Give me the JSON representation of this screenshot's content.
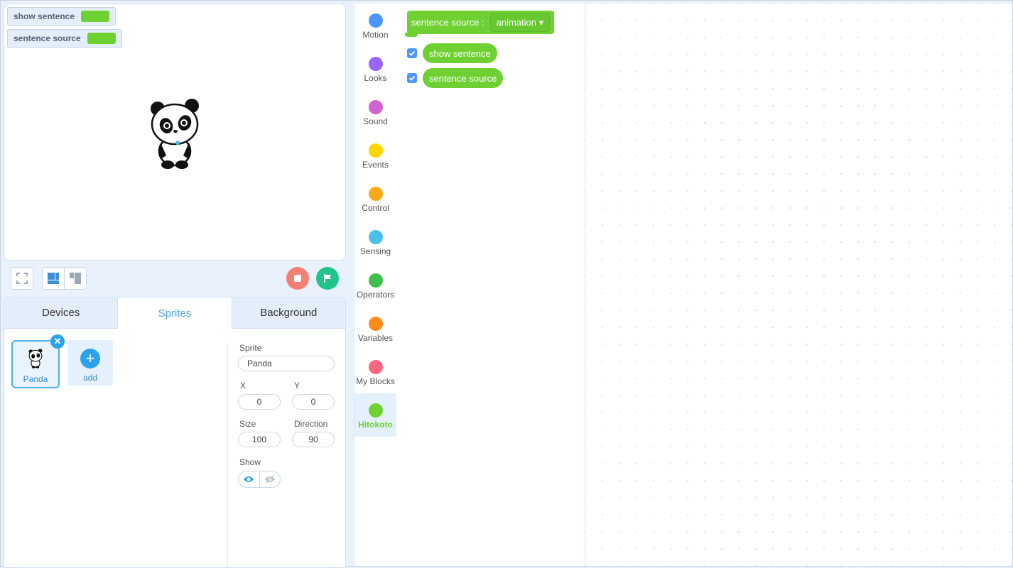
{
  "stage": {
    "monitors": [
      {
        "label": "show sentence"
      },
      {
        "label": "sentence source"
      }
    ],
    "sprite_icon": "panda-icon"
  },
  "stage_controls": {
    "fullscreen_icon": "fullscreen-icon",
    "layout_icons": [
      "large-stage-icon",
      "small-stage-icon"
    ],
    "stop_icon": "stop-icon",
    "go_icon": "green-flag-icon",
    "colors": {
      "stop": "#f47f72",
      "go": "#21c58a"
    }
  },
  "tabs": [
    {
      "label": "Devices",
      "active": false
    },
    {
      "label": "Sprites",
      "active": true
    },
    {
      "label": "Background",
      "active": false
    }
  ],
  "sprites": {
    "items": [
      {
        "name": "Panda",
        "selected": true
      }
    ],
    "add_label": "add",
    "delete_icon": "close-icon",
    "add_icon": "plus-icon"
  },
  "sprite_props": {
    "sprite_label": "Sprite",
    "sprite_name": "Panda",
    "x_label": "X",
    "x_value": "0",
    "y_label": "Y",
    "y_value": "0",
    "size_label": "Size",
    "size_value": "100",
    "direction_label": "Direction",
    "direction_value": "90",
    "show_label": "Show",
    "show_icons": [
      "eye-icon",
      "eye-off-icon"
    ]
  },
  "categories": [
    {
      "name": "Motion",
      "color": "#4c97ff"
    },
    {
      "name": "Looks",
      "color": "#9966ff"
    },
    {
      "name": "Sound",
      "color": "#cf63cf"
    },
    {
      "name": "Events",
      "color": "#ffd500"
    },
    {
      "name": "Control",
      "color": "#ffab19"
    },
    {
      "name": "Sensing",
      "color": "#4cbfe6"
    },
    {
      "name": "Operators",
      "color": "#40bf4a"
    },
    {
      "name": "Variables",
      "color": "#ff8c1a"
    },
    {
      "name": "My Blocks",
      "color": "#ff6680"
    },
    {
      "name": "Hitokoto",
      "color": "#6fd032",
      "active": true
    }
  ],
  "palette": {
    "hat_block": {
      "label": "sentence source :",
      "dropdown": "animation ▾"
    },
    "reporters": [
      {
        "label": "show sentence",
        "checked": true
      },
      {
        "label": "sentence source",
        "checked": true
      }
    ],
    "block_color": "#6fd032"
  }
}
